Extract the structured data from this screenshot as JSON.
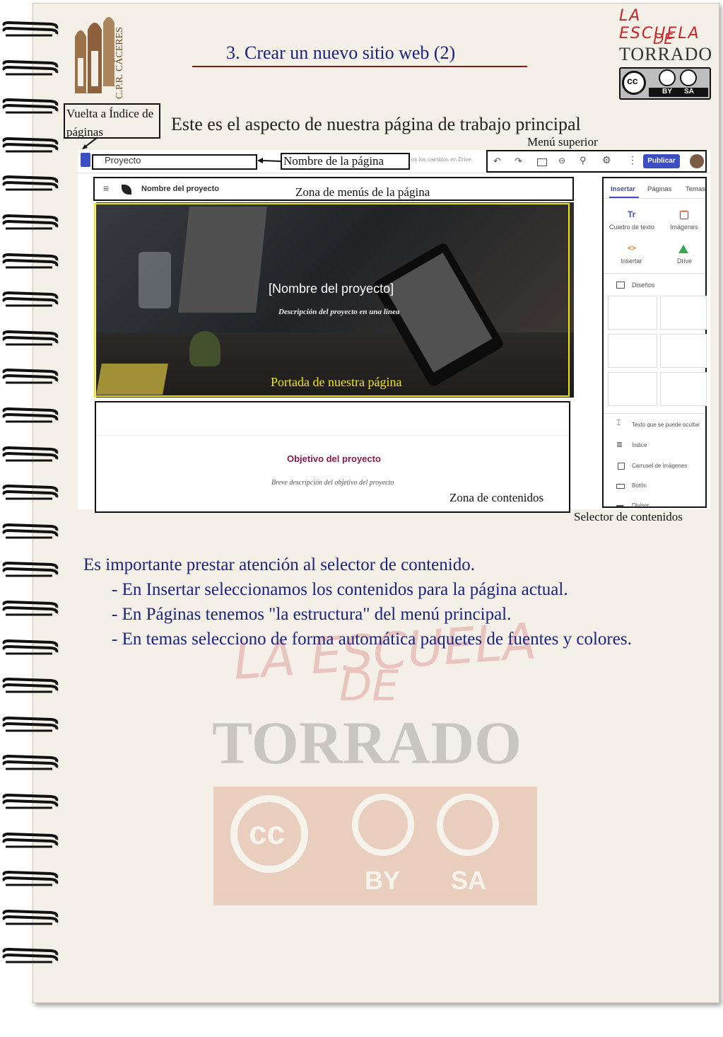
{
  "header": {
    "title": "3. Crear un nuevo sitio web (2)",
    "logo_text": "C.P.R. CÁCERES",
    "brand_line1": "LA ESCUELA",
    "brand_line2": "DE",
    "brand_line3": "TORRADO",
    "license_by": "BY",
    "license_sa": "SA",
    "license_cc": "cc"
  },
  "subtitle": "Este es el aspecto de nuestra página de trabajo principal",
  "annotations": {
    "back_to_index": "Vuelta a Índice de páginas",
    "page_name": "Nombre de la página",
    "top_menu": "Menú superior",
    "menu_zone": "Zona de menús de la página",
    "cover": "Portada de nuestra página",
    "content_zone": "Zona de contenidos",
    "content_selector": "Selector de contenidos"
  },
  "screenshot": {
    "project_field": "Proyecto",
    "saved_text": "os los cambios en Drive",
    "publish_button": "Publicar",
    "site_name": "Nombre del proyecto",
    "hero_title": "[Nombre del proyecto]",
    "hero_subtitle": "Descripción del proyecto en una línea",
    "objective_title": "Objetivo del proyecto",
    "objective_desc": "Breve descripción del objetivo del proyecto",
    "tabs": [
      "Insertar",
      "Páginas",
      "Temas"
    ],
    "insert_items": [
      "Cuadro de texto",
      "Imágenes",
      "Insertar",
      "Drive"
    ],
    "layouts_label": "Diseños",
    "list_items": [
      "Texto que se puede ocultar",
      "Índice",
      "Carrusel de imágenes",
      "Botón",
      "Divisor"
    ],
    "accent_color": "#3c4fc0",
    "objective_color": "#8e1a4a"
  },
  "body_text": {
    "intro": "Es importante prestar atención al selector de contenido.",
    "items": [
      "- En Insertar seleccionamos los contenidos para la página actual.",
      "- En Páginas tenemos \"la estructura\" del menú principal.",
      "- En temas selecciono de forma automática paquetes de fuentes y colores."
    ]
  },
  "watermark": {
    "line1": "LA ESCUELA",
    "line2": "DE",
    "line3": "TORRADO",
    "cc": "cc",
    "by": "BY",
    "sa": "SA"
  }
}
